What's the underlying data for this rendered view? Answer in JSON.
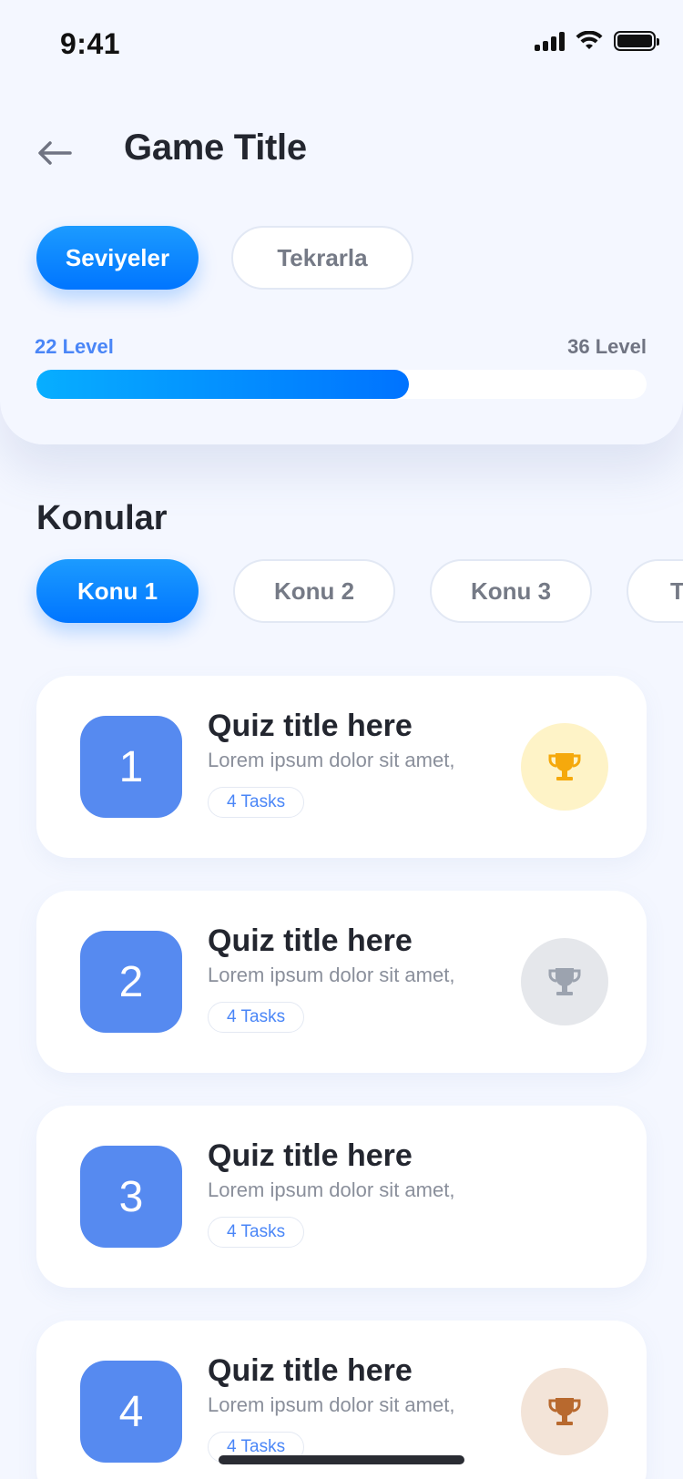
{
  "status_bar": {
    "time": "9:41"
  },
  "header": {
    "title": "Game Title",
    "back_icon": "arrow-left-icon"
  },
  "mode_tabs": [
    {
      "label": "Seviyeler",
      "active": true
    },
    {
      "label": "Tekrarla",
      "active": false
    }
  ],
  "progress": {
    "current_label": "22 Level",
    "total_label": "36 Level",
    "current": 22,
    "total": 36
  },
  "topics": {
    "section_title": "Konular",
    "tabs": [
      {
        "label": "Konu 1",
        "active": true
      },
      {
        "label": "Konu 2",
        "active": false
      },
      {
        "label": "Konu 3",
        "active": false
      },
      {
        "label": "Te",
        "active": false
      }
    ]
  },
  "quizzes": [
    {
      "number": "1",
      "title": "Quiz title here",
      "description": "Lorem ipsum dolor sit amet,",
      "tasks": "4 Tasks",
      "trophy": "gold"
    },
    {
      "number": "2",
      "title": "Quiz title here",
      "description": "Lorem ipsum dolor sit amet,",
      "tasks": "4 Tasks",
      "trophy": "silver"
    },
    {
      "number": "3",
      "title": "Quiz title here",
      "description": "Lorem ipsum dolor sit amet,",
      "tasks": "4 Tasks",
      "trophy": "none"
    },
    {
      "number": "4",
      "title": "Quiz title here",
      "description": "Lorem ipsum dolor sit amet,",
      "tasks": "4 Tasks",
      "trophy": "bronze"
    }
  ],
  "colors": {
    "accent": "#0075FF",
    "number_tile": "#568AF0",
    "trophy_gold_bg": "#FEF3C7",
    "trophy_gold": "#F5A90C",
    "trophy_silver_bg": "#E5E7EB",
    "trophy_silver": "#9CA3AF",
    "trophy_bronze_bg": "#F3E4D8",
    "trophy_bronze": "#B8692E"
  }
}
